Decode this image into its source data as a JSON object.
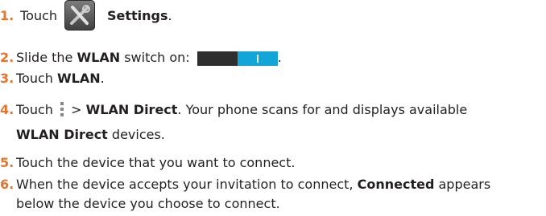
{
  "steps": [
    {
      "number": "1.",
      "parts": [
        "Touch",
        "Settings",
        "."
      ]
    },
    {
      "number": "2.",
      "parts": [
        "Slide the ",
        "WLAN",
        " switch on: ",
        "."
      ]
    },
    {
      "number": "3.",
      "parts": [
        "Touch ",
        "WLAN",
        "."
      ]
    },
    {
      "number": "4.",
      "parts": [
        "Touch ",
        " > ",
        "WLAN Direct",
        ". Your phone scans for and displays available"
      ],
      "continuation": [
        "WLAN Direct",
        " devices."
      ]
    },
    {
      "number": "5.",
      "parts": [
        "Touch the device that you want to connect."
      ]
    },
    {
      "number": "6.",
      "parts": [
        "When the device accepts your invitation to connect, ",
        "Connected",
        " appears"
      ],
      "continuation": [
        "below the device you choose to connect."
      ]
    }
  ],
  "icons": {
    "settings": "settings-icon",
    "switch": "wlan-switch-on-icon",
    "menu": "menu-dots-icon"
  },
  "colors": {
    "step_number": "#e5742e",
    "switch_on": "#12a6d8",
    "switch_off": "#2f2f2f"
  }
}
